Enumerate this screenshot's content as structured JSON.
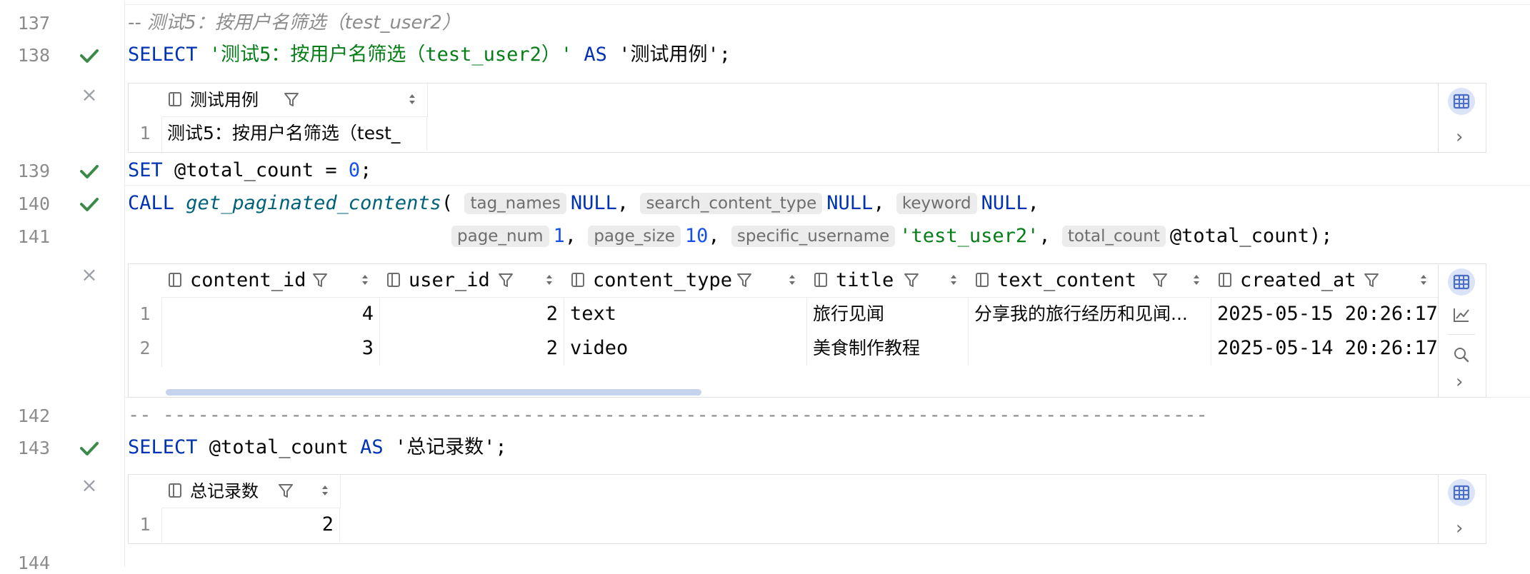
{
  "line_numbers": [
    "137",
    "138",
    "139",
    "140",
    "141",
    "142",
    "143",
    "144"
  ],
  "code": {
    "l137_comment": "-- 测试5：按用户名筛选（test_user2）",
    "l138": {
      "select": "SELECT",
      "str": "'测试5：按用户名筛选（test_user2）'",
      "as": "AS",
      "alias": "'测试用例'",
      "end": ";"
    },
    "l139": {
      "set": "SET",
      "var": " @total_count = ",
      "num": "0",
      "end": ";"
    },
    "l140": {
      "call": "CALL",
      "fn": "get_paginated_contents",
      "open": "(",
      "hint1": "tag_names",
      "v1": "NULL",
      "c1": ",",
      "hint2": "search_content_type",
      "v2": "NULL",
      "c2": ",",
      "hint3": "keyword",
      "v3": "NULL",
      "c3": ","
    },
    "l141": {
      "hint4": "page_num",
      "v4": "1",
      "c4": ",",
      "hint5": "page_size",
      "v5": "10",
      "c5": ",",
      "hint6": "specific_username",
      "v6": "'test_user2'",
      "c6": ",",
      "hint7": "total_count",
      "v7": "@total_count);"
    },
    "l142_comment": "-- ------------------------------------------------------------------------------------------",
    "l143": {
      "select": "SELECT",
      "var": " @total_count ",
      "as": "AS",
      "alias": "'总记录数'",
      "end": ";"
    }
  },
  "result1": {
    "columns": [
      "测试用例"
    ],
    "rows": [
      {
        "n": "1",
        "cells": [
          "测试5：按用户名筛选（test_"
        ]
      }
    ]
  },
  "result2": {
    "columns": [
      "content_id",
      "user_id",
      "content_type",
      "title",
      "text_content",
      "created_at"
    ],
    "rows": [
      {
        "n": "1",
        "cells": [
          "4",
          "2",
          "text",
          "旅行见闻",
          "分享我的旅行经历和见闻...",
          "2025-05-15 20:26:17"
        ]
      },
      {
        "n": "2",
        "cells": [
          "3",
          "2",
          "video",
          "美食制作教程",
          "",
          "2025-05-14 20:26:17"
        ]
      }
    ]
  },
  "result3": {
    "columns": [
      "总记录数"
    ],
    "rows": [
      {
        "n": "1",
        "cells": [
          "2"
        ]
      }
    ]
  },
  "icons": {
    "check": "checkmark-icon",
    "close": "close-icon",
    "table_view": "table-view-icon",
    "chart": "chart-icon",
    "search": "search-icon",
    "expand": "chevron-right-icon",
    "filter": "filter-icon",
    "sort": "sort-icon",
    "column": "column-icon"
  },
  "colors": {
    "keyword": "#0033b3",
    "string": "#067d17",
    "number": "#1750eb",
    "function": "#00627a",
    "comment": "#8c8c8c",
    "success": "#3c8a4a"
  },
  "glyphs": {
    "close": "×",
    "chevron": "›"
  }
}
